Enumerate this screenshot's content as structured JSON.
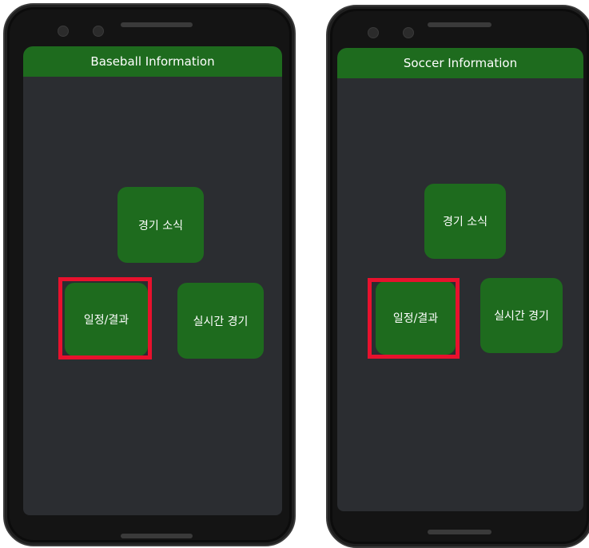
{
  "left_app": {
    "title": "Baseball Information",
    "buttons": {
      "news": "경기 소식",
      "schedule": "일정/결과",
      "live": "실시간 경기"
    }
  },
  "right_app": {
    "title": "Soccer Information",
    "buttons": {
      "news": "경기 소식",
      "schedule": "일정/결과",
      "live": "실시간 경기"
    }
  },
  "colors": {
    "app_bar": "#1e6b1e",
    "button": "#1e6b1e",
    "background": "#2b2d31",
    "highlight": "#e8112d"
  }
}
